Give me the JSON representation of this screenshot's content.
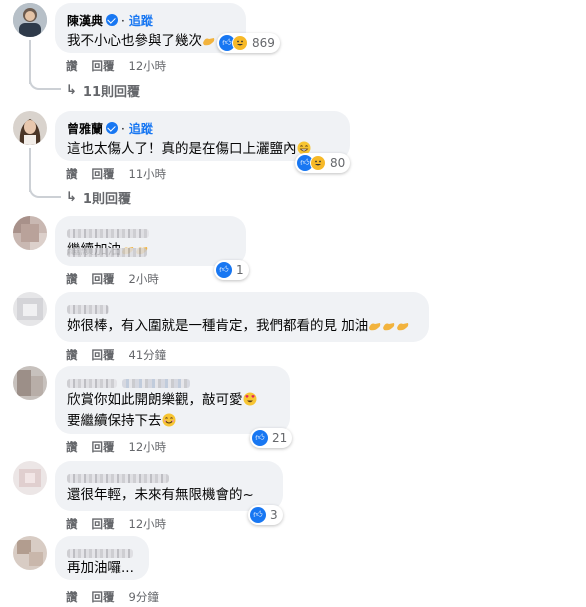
{
  "comments": [
    {
      "name": "陳漢典",
      "follow": "追蹤",
      "text": "我不小心也參與了幾次",
      "reactions": "869",
      "actions": [
        "讚",
        "回覆"
      ],
      "time": "12小時",
      "replies": "11則回覆"
    },
    {
      "name": "曾雅蘭",
      "follow": "追蹤",
      "text": "這也太傷人了！真的是在傷口上灑鹽內",
      "reactions": "80",
      "actions": [
        "讚",
        "回覆"
      ],
      "time": "11小時",
      "replies": "1則回覆"
    },
    {
      "text": "繼續加油",
      "reactions": "1",
      "actions": [
        "讚",
        "回覆"
      ],
      "time": "2小時"
    },
    {
      "text": "妳很棒，有入圍就是一種肯定，我們都看的見 加油",
      "actions": [
        "讚",
        "回覆"
      ],
      "time": "41分鐘"
    },
    {
      "text_line1": "欣賞你如此開朗樂觀，敲可愛",
      "text_line2": "要繼續保持下去",
      "reactions": "21",
      "actions": [
        "讚",
        "回覆"
      ],
      "time": "12小時"
    },
    {
      "text": "還很年輕，未來有無限機會的~",
      "reactions": "3",
      "actions": [
        "讚",
        "回覆"
      ],
      "time": "12小時"
    },
    {
      "text": "再加油囉...",
      "actions": [
        "讚",
        "回覆"
      ],
      "time": "9分鐘"
    }
  ],
  "colors": {
    "bubble": "#f0f2f5",
    "accent": "#1877f2",
    "meta": "#65676b",
    "haha": "#f7b928"
  },
  "icons": [
    "verified-badge-icon",
    "like-reaction-icon",
    "haha-reaction-icon",
    "reply-arrow-icon",
    "flexed-biceps-emoji",
    "smiling-emoji",
    "heart-eyes-emoji"
  ]
}
